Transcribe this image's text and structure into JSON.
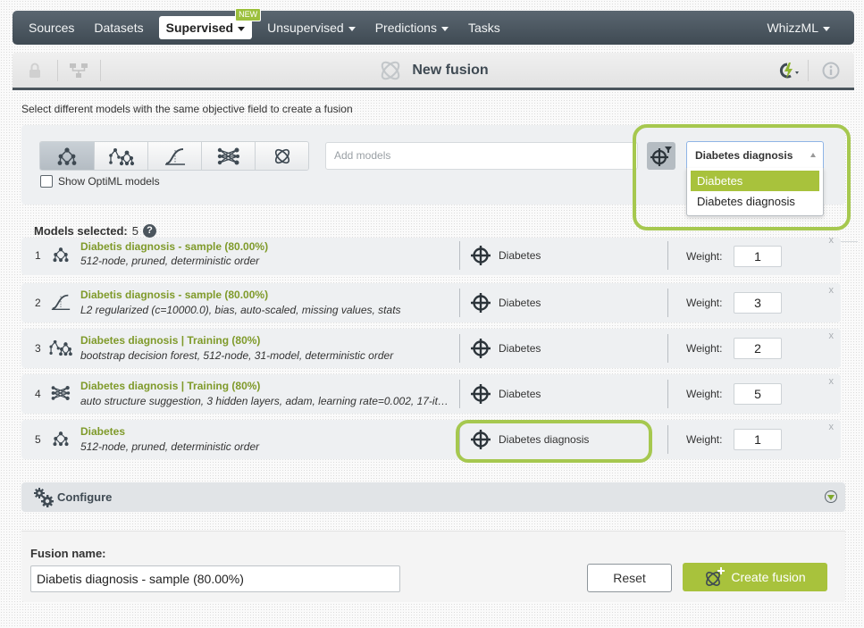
{
  "nav": {
    "items": [
      {
        "label": "Sources"
      },
      {
        "label": "Datasets"
      },
      {
        "label": "Supervised",
        "badge": "NEW"
      },
      {
        "label": "Unsupervised"
      },
      {
        "label": "Predictions"
      },
      {
        "label": "Tasks"
      }
    ],
    "right": "WhizzML"
  },
  "toolbar": {
    "title": "New fusion"
  },
  "instructions": "Select different models with the same objective field to create a fusion",
  "selector": {
    "model_types": [
      "model",
      "ensemble",
      "logistic-regression",
      "deepnet",
      "fusion"
    ],
    "optiml_label": "Show OptiML models",
    "optiml_checked": false,
    "add_models_placeholder": "Add models",
    "objective_selected": "Diabetes diagnosis",
    "objective_options": [
      {
        "label": "Diabetes",
        "highlighted": true
      },
      {
        "label": "Diabetes diagnosis",
        "highlighted": false
      }
    ]
  },
  "models_header": {
    "label": "Models selected:",
    "count": "5",
    "help": "?"
  },
  "models": [
    {
      "num": "1",
      "type": "model",
      "name": "Diabetis diagnosis - sample (80.00%)",
      "desc": "512-node, pruned, deterministic order",
      "objective": "Diabetes",
      "weight_label": "Weight:",
      "weight": "1",
      "close": "x"
    },
    {
      "num": "2",
      "type": "logistic-regression",
      "name": "Diabetis diagnosis - sample (80.00%)",
      "desc": "L2 regularized (c=10000.0), bias, auto-scaled, missing values, stats",
      "objective": "Diabetes",
      "weight_label": "Weight:",
      "weight": "3",
      "close": "x"
    },
    {
      "num": "3",
      "type": "ensemble",
      "name": "Diabetes diagnosis | Training (80%)",
      "desc": "bootstrap decision forest, 512-node, 31-model, deterministic order",
      "objective": "Diabetes",
      "weight_label": "Weight:",
      "weight": "2",
      "close": "x"
    },
    {
      "num": "4",
      "type": "deepnet",
      "name": "Diabetes diagnosis | Training (80%)",
      "desc": "auto structure suggestion, 3 hidden layers, adam, learning rate=0.002, 17-ite…",
      "objective": "Diabetes",
      "weight_label": "Weight:",
      "weight": "5",
      "close": "x"
    },
    {
      "num": "5",
      "type": "model",
      "name": "Diabetes",
      "desc": "512-node, pruned, deterministic order",
      "objective": "Diabetes diagnosis",
      "weight_label": "Weight:",
      "weight": "1",
      "close": "x"
    }
  ],
  "configure": {
    "label": "Configure"
  },
  "bottom": {
    "fusion_name_label": "Fusion name:",
    "fusion_name_value": "Diabetis diagnosis - sample (80.00%)",
    "reset_label": "Reset",
    "create_label": "Create fusion"
  },
  "colors": {
    "accent": "#a8c23c",
    "link": "#7f9a2a",
    "nav_bg": "#4a555e",
    "highlight": "#a6c84f"
  }
}
